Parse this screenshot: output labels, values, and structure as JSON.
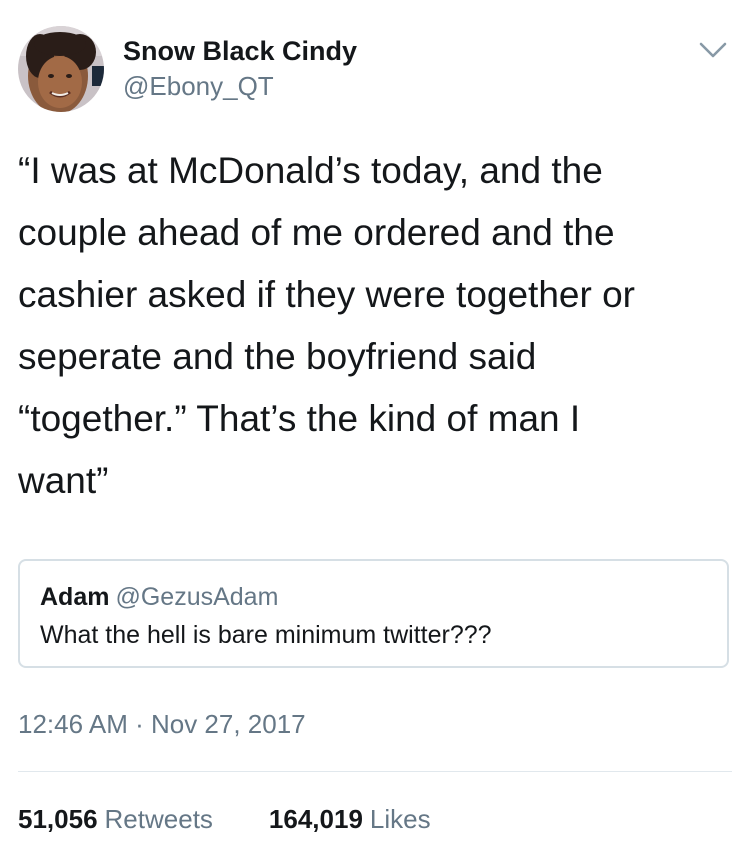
{
  "author": {
    "display_name": "Snow Black Cindy",
    "handle": "@Ebony_QT"
  },
  "tweet": {
    "text": "“I was at McDonald’s today, and the\ncouple ahead of me ordered and the\ncashier asked if they were together or\nseperate and the boyfriend said\n“together.” That’s the kind of man I\nwant”"
  },
  "quoted_tweet": {
    "name": "Adam",
    "handle": "@GezusAdam",
    "text": "What the hell is bare minimum twitter???"
  },
  "timestamp": "12:46 AM · Nov 27, 2017",
  "stats": {
    "retweets_count": "51,056",
    "retweets_label": "Retweets",
    "likes_count": "164,019",
    "likes_label": "Likes"
  },
  "icons": {
    "caret": "chevron-down-icon",
    "avatar": "profile-photo"
  },
  "colors": {
    "text_primary": "#14171a",
    "text_secondary": "#657786",
    "border": "#d6dfe5",
    "divider": "#e1e8ed"
  }
}
